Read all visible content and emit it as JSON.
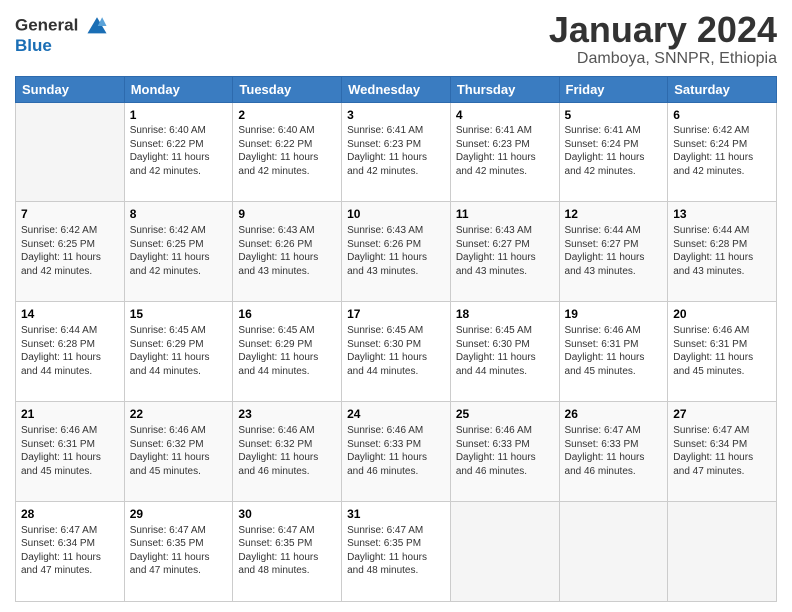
{
  "header": {
    "logo_line1": "General",
    "logo_line2": "Blue",
    "month_title": "January 2024",
    "location": "Damboya, SNNPR, Ethiopia"
  },
  "days_of_week": [
    "Sunday",
    "Monday",
    "Tuesday",
    "Wednesday",
    "Thursday",
    "Friday",
    "Saturday"
  ],
  "weeks": [
    [
      {
        "day": "",
        "info": ""
      },
      {
        "day": "1",
        "info": "Sunrise: 6:40 AM\nSunset: 6:22 PM\nDaylight: 11 hours\nand 42 minutes."
      },
      {
        "day": "2",
        "info": "Sunrise: 6:40 AM\nSunset: 6:22 PM\nDaylight: 11 hours\nand 42 minutes."
      },
      {
        "day": "3",
        "info": "Sunrise: 6:41 AM\nSunset: 6:23 PM\nDaylight: 11 hours\nand 42 minutes."
      },
      {
        "day": "4",
        "info": "Sunrise: 6:41 AM\nSunset: 6:23 PM\nDaylight: 11 hours\nand 42 minutes."
      },
      {
        "day": "5",
        "info": "Sunrise: 6:41 AM\nSunset: 6:24 PM\nDaylight: 11 hours\nand 42 minutes."
      },
      {
        "day": "6",
        "info": "Sunrise: 6:42 AM\nSunset: 6:24 PM\nDaylight: 11 hours\nand 42 minutes."
      }
    ],
    [
      {
        "day": "7",
        "info": "Sunrise: 6:42 AM\nSunset: 6:25 PM\nDaylight: 11 hours\nand 42 minutes."
      },
      {
        "day": "8",
        "info": "Sunrise: 6:42 AM\nSunset: 6:25 PM\nDaylight: 11 hours\nand 42 minutes."
      },
      {
        "day": "9",
        "info": "Sunrise: 6:43 AM\nSunset: 6:26 PM\nDaylight: 11 hours\nand 43 minutes."
      },
      {
        "day": "10",
        "info": "Sunrise: 6:43 AM\nSunset: 6:26 PM\nDaylight: 11 hours\nand 43 minutes."
      },
      {
        "day": "11",
        "info": "Sunrise: 6:43 AM\nSunset: 6:27 PM\nDaylight: 11 hours\nand 43 minutes."
      },
      {
        "day": "12",
        "info": "Sunrise: 6:44 AM\nSunset: 6:27 PM\nDaylight: 11 hours\nand 43 minutes."
      },
      {
        "day": "13",
        "info": "Sunrise: 6:44 AM\nSunset: 6:28 PM\nDaylight: 11 hours\nand 43 minutes."
      }
    ],
    [
      {
        "day": "14",
        "info": "Sunrise: 6:44 AM\nSunset: 6:28 PM\nDaylight: 11 hours\nand 44 minutes."
      },
      {
        "day": "15",
        "info": "Sunrise: 6:45 AM\nSunset: 6:29 PM\nDaylight: 11 hours\nand 44 minutes."
      },
      {
        "day": "16",
        "info": "Sunrise: 6:45 AM\nSunset: 6:29 PM\nDaylight: 11 hours\nand 44 minutes."
      },
      {
        "day": "17",
        "info": "Sunrise: 6:45 AM\nSunset: 6:30 PM\nDaylight: 11 hours\nand 44 minutes."
      },
      {
        "day": "18",
        "info": "Sunrise: 6:45 AM\nSunset: 6:30 PM\nDaylight: 11 hours\nand 44 minutes."
      },
      {
        "day": "19",
        "info": "Sunrise: 6:46 AM\nSunset: 6:31 PM\nDaylight: 11 hours\nand 45 minutes."
      },
      {
        "day": "20",
        "info": "Sunrise: 6:46 AM\nSunset: 6:31 PM\nDaylight: 11 hours\nand 45 minutes."
      }
    ],
    [
      {
        "day": "21",
        "info": "Sunrise: 6:46 AM\nSunset: 6:31 PM\nDaylight: 11 hours\nand 45 minutes."
      },
      {
        "day": "22",
        "info": "Sunrise: 6:46 AM\nSunset: 6:32 PM\nDaylight: 11 hours\nand 45 minutes."
      },
      {
        "day": "23",
        "info": "Sunrise: 6:46 AM\nSunset: 6:32 PM\nDaylight: 11 hours\nand 46 minutes."
      },
      {
        "day": "24",
        "info": "Sunrise: 6:46 AM\nSunset: 6:33 PM\nDaylight: 11 hours\nand 46 minutes."
      },
      {
        "day": "25",
        "info": "Sunrise: 6:46 AM\nSunset: 6:33 PM\nDaylight: 11 hours\nand 46 minutes."
      },
      {
        "day": "26",
        "info": "Sunrise: 6:47 AM\nSunset: 6:33 PM\nDaylight: 11 hours\nand 46 minutes."
      },
      {
        "day": "27",
        "info": "Sunrise: 6:47 AM\nSunset: 6:34 PM\nDaylight: 11 hours\nand 47 minutes."
      }
    ],
    [
      {
        "day": "28",
        "info": "Sunrise: 6:47 AM\nSunset: 6:34 PM\nDaylight: 11 hours\nand 47 minutes."
      },
      {
        "day": "29",
        "info": "Sunrise: 6:47 AM\nSunset: 6:35 PM\nDaylight: 11 hours\nand 47 minutes."
      },
      {
        "day": "30",
        "info": "Sunrise: 6:47 AM\nSunset: 6:35 PM\nDaylight: 11 hours\nand 48 minutes."
      },
      {
        "day": "31",
        "info": "Sunrise: 6:47 AM\nSunset: 6:35 PM\nDaylight: 11 hours\nand 48 minutes."
      },
      {
        "day": "",
        "info": ""
      },
      {
        "day": "",
        "info": ""
      },
      {
        "day": "",
        "info": ""
      }
    ]
  ]
}
